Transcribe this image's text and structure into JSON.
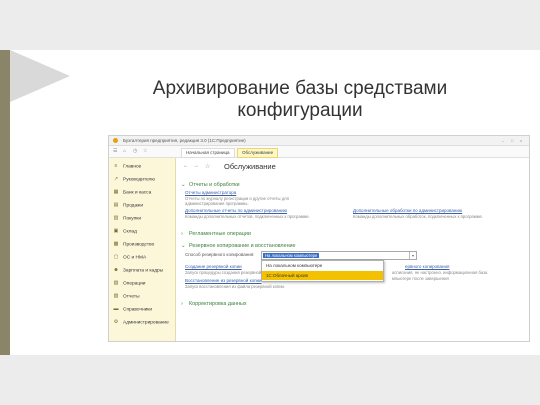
{
  "slide": {
    "title_line1": "Архивирование базы средствами",
    "title_line2": "конфигурации"
  },
  "window": {
    "title": "Бухгалтерия предприятия, редакция 3.0  (1С:Предприятие)",
    "controls": [
      "–",
      "□",
      "×"
    ]
  },
  "toolbar": {
    "tabs": [
      {
        "label": "Начальная страница",
        "active": false
      },
      {
        "label": "Обслуживание",
        "active": true
      }
    ]
  },
  "sidebar": {
    "items": [
      {
        "label": "Главное",
        "icon": "list-icon"
      },
      {
        "label": "Руководителю",
        "icon": "chart-icon"
      },
      {
        "label": "Банк и касса",
        "icon": "bank-icon"
      },
      {
        "label": "Продажи",
        "icon": "sales-icon"
      },
      {
        "label": "Покупки",
        "icon": "cart-icon"
      },
      {
        "label": "Склад",
        "icon": "warehouse-icon"
      },
      {
        "label": "Производство",
        "icon": "factory-icon"
      },
      {
        "label": "ОС и НМА",
        "icon": "assets-icon"
      },
      {
        "label": "Зарплата и кадры",
        "icon": "people-icon"
      },
      {
        "label": "Операции",
        "icon": "operations-icon"
      },
      {
        "label": "Отчеты",
        "icon": "report-icon"
      },
      {
        "label": "Справочники",
        "icon": "book-icon"
      },
      {
        "label": "Администрирование",
        "icon": "gear-icon"
      }
    ]
  },
  "main": {
    "page_title": "Обслуживание",
    "sections": {
      "reports": "Отчеты и обработки",
      "reports_link1": "Отчеты администратора",
      "reports_desc1": "Отчеты по журналу регистрации и другие отчеты для",
      "reports_desc1b": "администрирования программы.",
      "reports_link2": "Дополнительные отчеты по администрированию",
      "reports_desc2": "Команды дополнительных отчетов, подключенных к программе.",
      "reports_link3": "Дополнительные обработки по администрированию",
      "reports_desc3": "Команды дополнительных обработок, подключенных к программе.",
      "regulations": "Регламентные операции",
      "backup": "Резервное копирование и восстановление",
      "backup_label": "Способ резервного копирования:",
      "backup_value": "На локальном компьютере",
      "backup_link1": "Создание резервной копии",
      "backup_desc1": "Запуск процедуры создания резервной",
      "backup_link2": "Восстановление из резервной копии",
      "backup_desc2": "Запуск восстановления из файла резервной копии.",
      "backup_right_link": "ервного копирования",
      "backup_right_desc1": "асписания, не настроено, информационная база",
      "backup_right_desc2": "мпьютере после завершения",
      "data": "Корректировка данных"
    },
    "dropdown": {
      "options": [
        "На локальном компьютере",
        "1С:Облачный архив"
      ],
      "highlighted": 1
    }
  },
  "colors": {
    "sidebar_bg": "#fdf7da",
    "section_green": "#3a7f3a",
    "link_blue": "#3b5fa8",
    "highlight": "#f4c100"
  }
}
